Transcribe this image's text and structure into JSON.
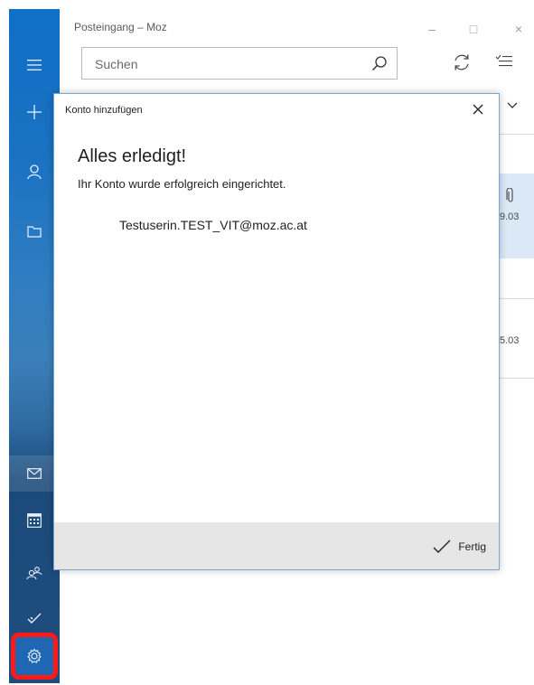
{
  "window": {
    "title": "Posteingang – Moz",
    "controls": {
      "minimize": "–",
      "maximize": "□",
      "close": "×"
    }
  },
  "search": {
    "placeholder": "Suchen"
  },
  "rail": {
    "items": [
      "menu-icon",
      "new-mail-icon",
      "account-icon",
      "folder-icon",
      "mail-icon",
      "calendar-icon",
      "people-icon",
      "todo-icon",
      "settings-icon"
    ]
  },
  "message_list": {
    "dates": [
      "9.03",
      "5.03"
    ]
  },
  "dialog": {
    "title": "Konto hinzufügen",
    "heading": "Alles erledigt!",
    "subtitle": "Ihr Konto wurde erfolgreich eingerichtet.",
    "email": "Testuserin.TEST_VIT@moz.ac.at",
    "done_label": "Fertig"
  },
  "colors": {
    "rail_top": "#0f6fc6",
    "highlight": "#ff1a1a",
    "accent": "#0078d7"
  }
}
